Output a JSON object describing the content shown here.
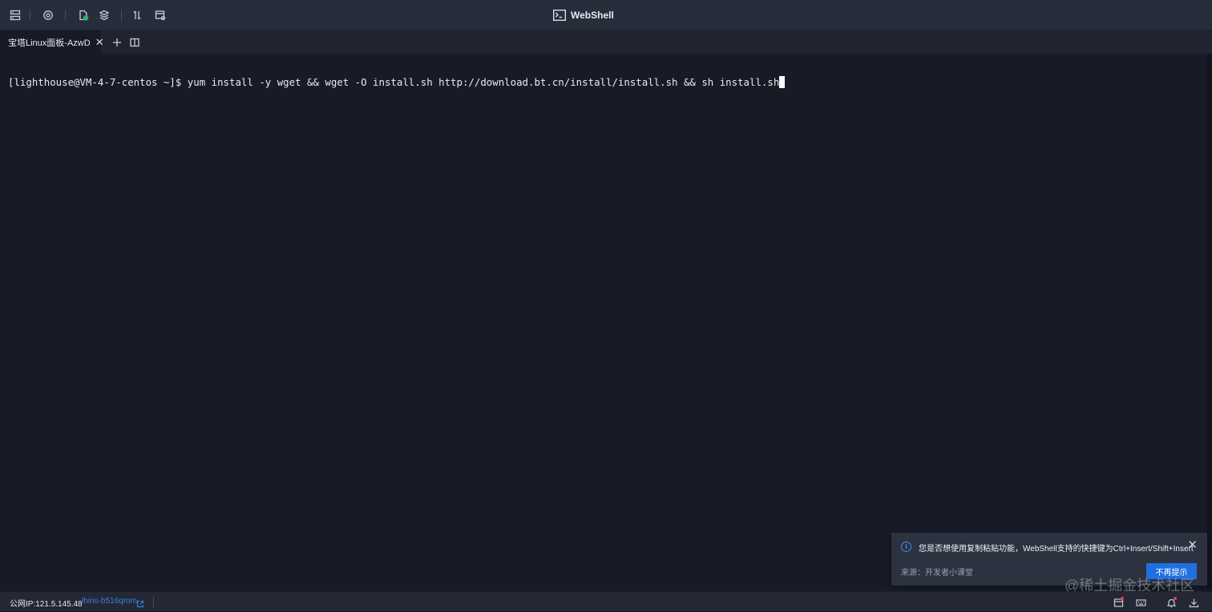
{
  "topbar": {
    "title": "WebShell",
    "icons": [
      "server-list-icon",
      "settings-icon",
      "file-check-icon",
      "layers-icon",
      "transfer-icon",
      "history-icon"
    ]
  },
  "tabs": [
    {
      "label": "宝塔Linux面板-AzwD",
      "close": "✕"
    }
  ],
  "tabbar": {
    "add_symbol": "+"
  },
  "terminal": {
    "prompt": "[lighthouse@VM-4-7-centos ~]$ ",
    "command": "yum install -y wget && wget -O install.sh http://download.bt.cn/install/install.sh && sh install.sh"
  },
  "notification": {
    "message": "您是否想使用复制粘贴功能，WebShell支持的快捷键为Ctrl+Insert/Shift+Insert",
    "source": "来源：开发者小课堂",
    "button_label": "不再提示",
    "info_symbol": "i",
    "close_symbol": "✕"
  },
  "status": {
    "public_ip": "公网IP:121.5.145.48",
    "instance_id": "lhins-b516qrom"
  },
  "watermark": "@稀土掘金技术社区",
  "colors": {
    "background": "#171b26",
    "topbar": "#272d3b",
    "accent": "#1f6fe5",
    "link": "#3d7fe0",
    "badge": "#e54545",
    "success": "#2fb36b"
  }
}
